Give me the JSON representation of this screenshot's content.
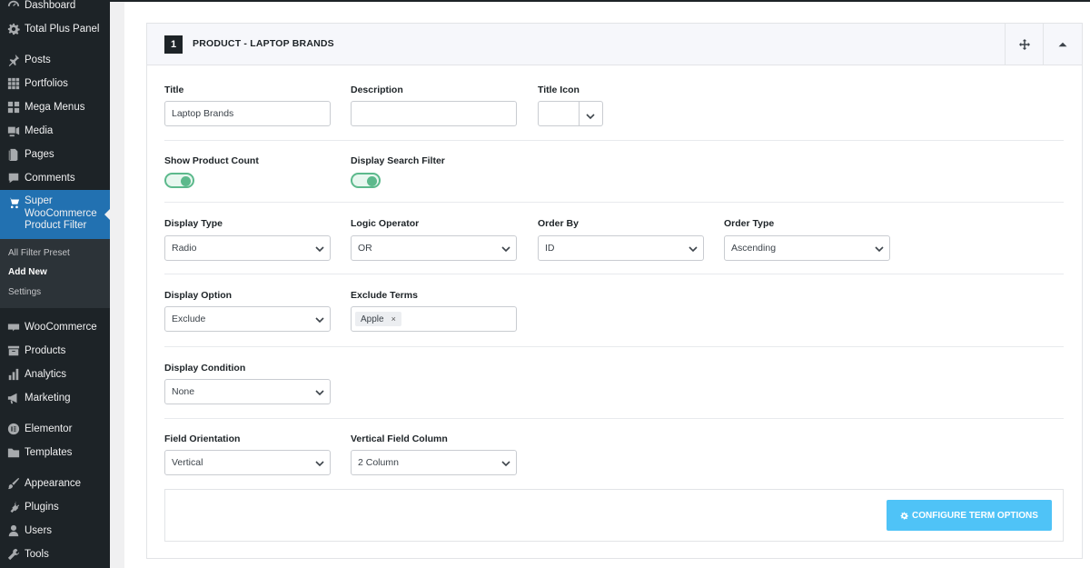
{
  "sidebar": {
    "items": [
      {
        "label": "Dashboard",
        "icon": "dashboard-icon"
      },
      {
        "label": "Total Plus Panel",
        "icon": "gear-icon"
      },
      {
        "label": "Posts",
        "icon": "pin-icon"
      },
      {
        "label": "Portfolios",
        "icon": "grid-icon"
      },
      {
        "label": "Mega Menus",
        "icon": "grid-icon"
      },
      {
        "label": "Media",
        "icon": "media-icon"
      },
      {
        "label": "Pages",
        "icon": "page-icon"
      },
      {
        "label": "Comments",
        "icon": "comment-icon"
      },
      {
        "label": "Super WooCommerce Product Filter",
        "icon": "cart-icon"
      },
      {
        "label": "WooCommerce",
        "icon": "woo-icon"
      },
      {
        "label": "Products",
        "icon": "archive-icon"
      },
      {
        "label": "Analytics",
        "icon": "bar-chart-icon"
      },
      {
        "label": "Marketing",
        "icon": "megaphone-icon"
      },
      {
        "label": "Elementor",
        "icon": "elementor-icon"
      },
      {
        "label": "Templates",
        "icon": "folder-icon"
      },
      {
        "label": "Appearance",
        "icon": "brush-icon"
      },
      {
        "label": "Plugins",
        "icon": "plug-icon"
      },
      {
        "label": "Users",
        "icon": "user-icon"
      },
      {
        "label": "Tools",
        "icon": "wrench-icon"
      }
    ],
    "active_lines": [
      "Super",
      "WooCommerce",
      "Product Filter"
    ],
    "submenu": [
      "All Filter Preset",
      "Add New",
      "Settings"
    ]
  },
  "card": {
    "number": "1",
    "title": "PRODUCT - LAPTOP BRANDS"
  },
  "fields": {
    "title": {
      "label": "Title",
      "value": "Laptop Brands"
    },
    "description": {
      "label": "Description",
      "value": ""
    },
    "title_icon": {
      "label": "Title Icon"
    },
    "show_product_count": {
      "label": "Show Product Count",
      "on": true
    },
    "display_search_filter": {
      "label": "Display Search Filter",
      "on": true
    },
    "display_type": {
      "label": "Display Type",
      "value": "Radio"
    },
    "logic_operator": {
      "label": "Logic Operator",
      "value": "OR"
    },
    "order_by": {
      "label": "Order By",
      "value": "ID"
    },
    "order_type": {
      "label": "Order Type",
      "value": "Ascending"
    },
    "display_option": {
      "label": "Display Option",
      "value": "Exclude"
    },
    "exclude_terms": {
      "label": "Exclude Terms",
      "tags": [
        "Apple"
      ],
      "remove": "×"
    },
    "display_condition": {
      "label": "Display Condition",
      "value": "None"
    },
    "field_orientation": {
      "label": "Field Orientation",
      "value": "Vertical"
    },
    "vertical_field_column": {
      "label": "Vertical Field Column",
      "value": "2 Column"
    }
  },
  "buttons": {
    "configure": "CONFIGURE TERM OPTIONS"
  },
  "colors": {
    "sidebar_bg": "#1d2327",
    "active_bg": "#2271b1",
    "toggle_green": "#5cb98c",
    "configure_btn": "#4fc3f7"
  }
}
